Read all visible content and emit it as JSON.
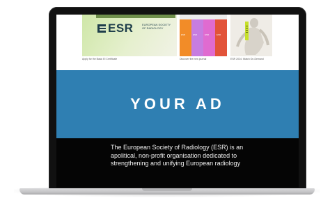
{
  "cards": [
    {
      "banner": "",
      "logo_word": "ESR",
      "logo_sub": "EUROPEAN SOCIETY OF RADIOLOGY",
      "caption": "Apply for the Basic EI Certificate"
    },
    {
      "caption": "Discover the new journal",
      "stripe_colors": [
        "#f28c28",
        "#c77de0",
        "#e06bd0",
        "#e2533a"
      ],
      "stripe_labels": [
        "ESR",
        "ESR",
        "ESR",
        "ESR"
      ]
    },
    {
      "caption": "ESR 2024: Watch On-Demand"
    }
  ],
  "ad": {
    "text": "YOUR AD",
    "color": "#2f7fb2"
  },
  "footer": {
    "about": "The European Society of Radiology (ESR) is an apolitical, non-profit organisation dedicated to strengthening and unifying European radiology",
    "accent": "#c7e02a"
  }
}
